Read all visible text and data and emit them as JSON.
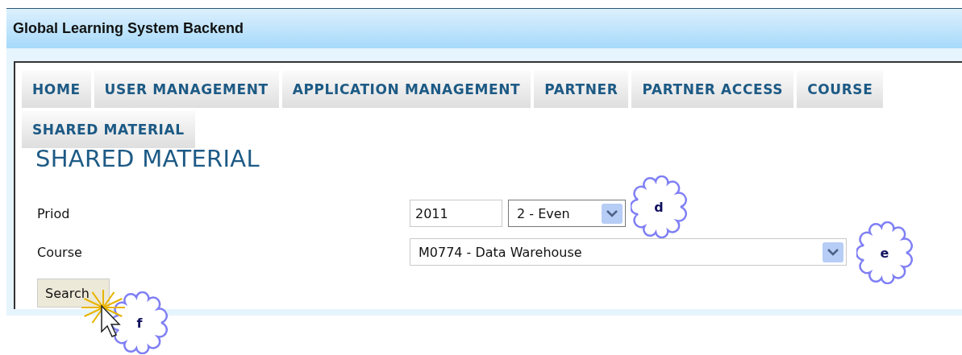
{
  "window": {
    "title": "Global Learning System Backend"
  },
  "nav": {
    "items": [
      {
        "label": "HOME"
      },
      {
        "label": "USER MANAGEMENT"
      },
      {
        "label": "APPLICATION MANAGEMENT"
      },
      {
        "label": "PARTNER"
      },
      {
        "label": "PARTNER ACCESS"
      },
      {
        "label": "COURSE"
      },
      {
        "label": "SHARED MATERIAL"
      }
    ]
  },
  "page_title": "SHARED MATERIAL",
  "form": {
    "period": {
      "label": "Priod",
      "year": "2011",
      "semester": "2 - Even"
    },
    "course": {
      "label": "Course",
      "value": "M0774 - Data Warehouse"
    },
    "search_button": "Search"
  },
  "callouts": [
    {
      "letter": "d"
    },
    {
      "letter": "e"
    },
    {
      "letter": "f"
    }
  ]
}
